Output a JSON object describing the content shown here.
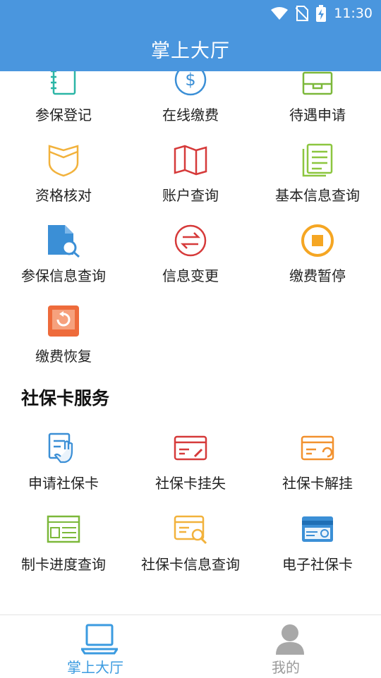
{
  "status_bar": {
    "time": "11:30"
  },
  "header": {
    "title": "掌上大厅"
  },
  "hall_services": [
    {
      "label": "参保登记",
      "icon": "register-icon",
      "color": "#2bb5a6"
    },
    {
      "label": "在线缴费",
      "icon": "online-payment-icon",
      "color": "#3b8fd6"
    },
    {
      "label": "待遇申请",
      "icon": "benefit-apply-icon",
      "color": "#7cb83a"
    },
    {
      "label": "资格核对",
      "icon": "qualification-shield-icon",
      "color": "#f2b23c"
    },
    {
      "label": "账户查询",
      "icon": "map-account-icon",
      "color": "#d63a3a"
    },
    {
      "label": "基本信息查询",
      "icon": "document-stack-icon",
      "color": "#8cc63f"
    },
    {
      "label": "参保信息查询",
      "icon": "file-search-icon",
      "color": "#3b8fd6"
    },
    {
      "label": "信息变更",
      "icon": "swap-arrows-icon",
      "color": "#d63a3a"
    },
    {
      "label": "缴费暂停",
      "icon": "stop-circle-icon",
      "color": "#f5a623"
    },
    {
      "label": "缴费恢复",
      "icon": "restore-icon",
      "color": "#ee6b3b"
    }
  ],
  "card_section": {
    "title": "社保卡服务",
    "items": [
      {
        "label": "申请社保卡",
        "icon": "apply-hand-icon",
        "color": "#3b8fd6"
      },
      {
        "label": "社保卡挂失",
        "icon": "card-loss-icon",
        "color": "#d63a3a"
      },
      {
        "label": "社保卡解挂",
        "icon": "card-unlock-icon",
        "color": "#f2912e"
      },
      {
        "label": "制卡进度查询",
        "icon": "card-progress-icon",
        "color": "#7cb83a"
      },
      {
        "label": "社保卡信息查询",
        "icon": "card-info-search-icon",
        "color": "#f2b23c"
      },
      {
        "label": "电子社保卡",
        "icon": "e-card-icon",
        "color": "#3b8fd6"
      }
    ]
  },
  "tabbar": {
    "tabs": [
      {
        "label": "掌上大厅",
        "icon": "laptop-icon",
        "color": "#3b9be0",
        "active": true
      },
      {
        "label": "我的",
        "icon": "user-icon",
        "color": "#9a9a9a",
        "active": false
      }
    ]
  }
}
